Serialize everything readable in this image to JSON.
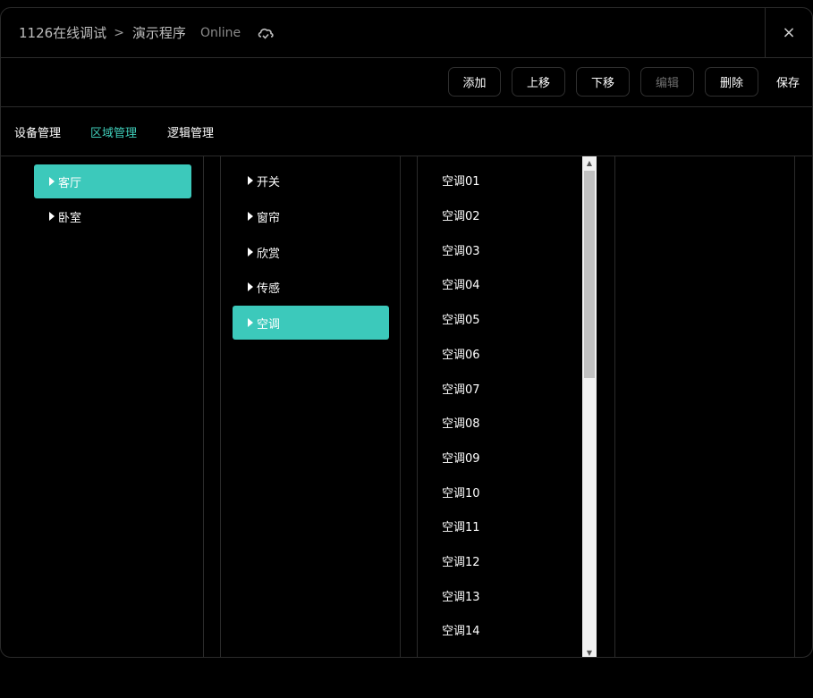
{
  "header": {
    "breadcrumb_root": "1126在线调试",
    "breadcrumb_separator": ">",
    "breadcrumb_current": "演示程序",
    "status": "Online",
    "close_label": "×"
  },
  "toolbar": {
    "add": "添加",
    "move_up": "上移",
    "move_down": "下移",
    "edit": "编辑",
    "delete": "删除",
    "save": "保存"
  },
  "tabs": [
    {
      "label": "设备管理"
    },
    {
      "label": "区域管理"
    },
    {
      "label": "逻辑管理"
    }
  ],
  "rooms": [
    {
      "label": "客厅"
    },
    {
      "label": "卧室"
    }
  ],
  "categories": [
    {
      "label": "开关"
    },
    {
      "label": "窗帘"
    },
    {
      "label": "欣赏"
    },
    {
      "label": "传感"
    },
    {
      "label": "空调"
    }
  ],
  "devices": [
    {
      "label": "空调01"
    },
    {
      "label": "空调02"
    },
    {
      "label": "空调03"
    },
    {
      "label": "空调04"
    },
    {
      "label": "空调05"
    },
    {
      "label": "空调06"
    },
    {
      "label": "空调07"
    },
    {
      "label": "空调08"
    },
    {
      "label": "空调09"
    },
    {
      "label": "空调10"
    },
    {
      "label": "空调11"
    },
    {
      "label": "空调12"
    },
    {
      "label": "空调13"
    },
    {
      "label": "空调14"
    }
  ],
  "colors": {
    "accent": "#3cc9bb",
    "active_tab": "#3fcdb9",
    "background": "#000000",
    "border": "#2b2b2b"
  },
  "icons": {
    "cloud": "cloud-sync-icon",
    "close": "close-icon",
    "expand": "triangle-right-icon"
  }
}
